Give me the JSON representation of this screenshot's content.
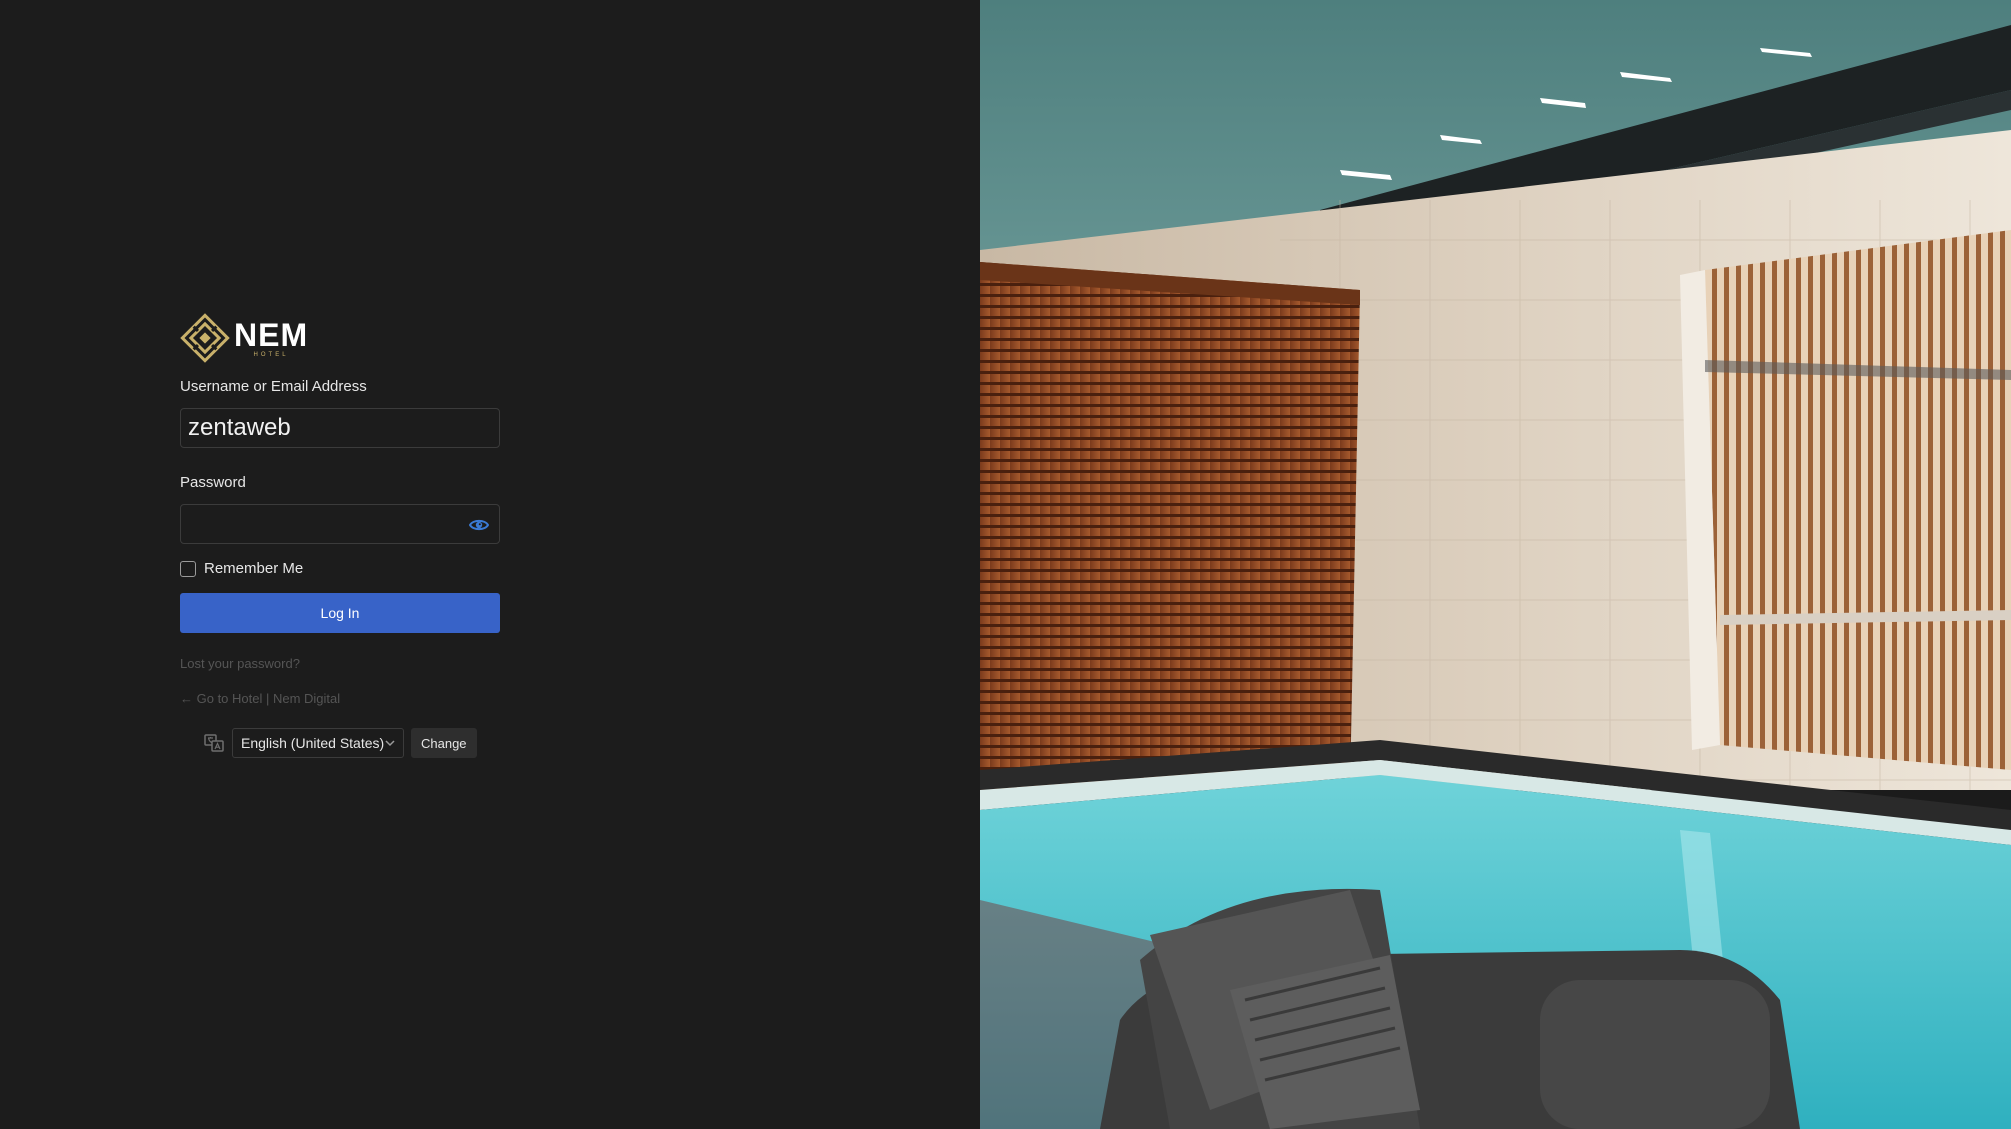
{
  "brand": {
    "logo_text": "NEM",
    "logo_subtext": "HOTEL",
    "gold": "#c9b16a"
  },
  "form": {
    "username_label": "Username or Email Address",
    "username_value": "zentaweb",
    "password_label": "Password",
    "password_value": "",
    "remember_label": "Remember Me",
    "remember_checked": false,
    "login_button": "Log In"
  },
  "links": {
    "lost_password": "Lost your password?",
    "back_to_site": "← Go to Hotel | Nem Digital"
  },
  "language": {
    "selected": "English (United States)",
    "change_button": "Change"
  },
  "colors": {
    "background": "#1c1c1c",
    "primary_button": "#3863c8",
    "eye_icon": "#3a7bd5"
  },
  "icons": {
    "password_toggle": "eye-icon",
    "language": "translate-icon",
    "dropdown": "chevron-down-icon",
    "logo": "diamond-knot-logo"
  }
}
